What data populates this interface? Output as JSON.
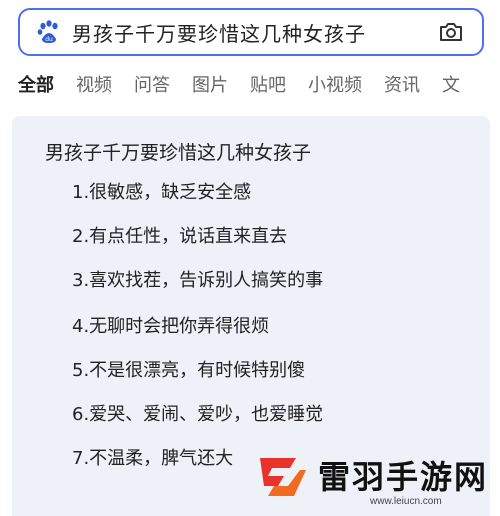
{
  "search": {
    "query": "男孩子千万要珍惜这几种女孩子",
    "logo_icon": "baidu-paw-icon",
    "camera_icon": "camera-icon",
    "accent_color": "#4e6ef2"
  },
  "tabs": [
    {
      "label": "全部",
      "active": true
    },
    {
      "label": "视频",
      "active": false
    },
    {
      "label": "问答",
      "active": false
    },
    {
      "label": "图片",
      "active": false
    },
    {
      "label": "贴吧",
      "active": false
    },
    {
      "label": "小视频",
      "active": false
    },
    {
      "label": "资讯",
      "active": false
    },
    {
      "label": "文",
      "active": false
    }
  ],
  "content": {
    "title": "男孩子千万要珍惜这几种女孩子",
    "items": [
      "1.很敏感，缺乏安全感",
      "2.有点任性，说话直来直去",
      "3.喜欢找茬，告诉别人搞笑的事",
      "4.无聊时会把你弄得很烦",
      "5.不是很漂亮，有时候特别傻",
      "6.爱哭、爱闹、爱吵，也爱睡觉",
      "7.不温柔，脾气还大"
    ]
  },
  "watermark": {
    "name": "雷羽手游网",
    "url": "www.leiucn.com"
  }
}
